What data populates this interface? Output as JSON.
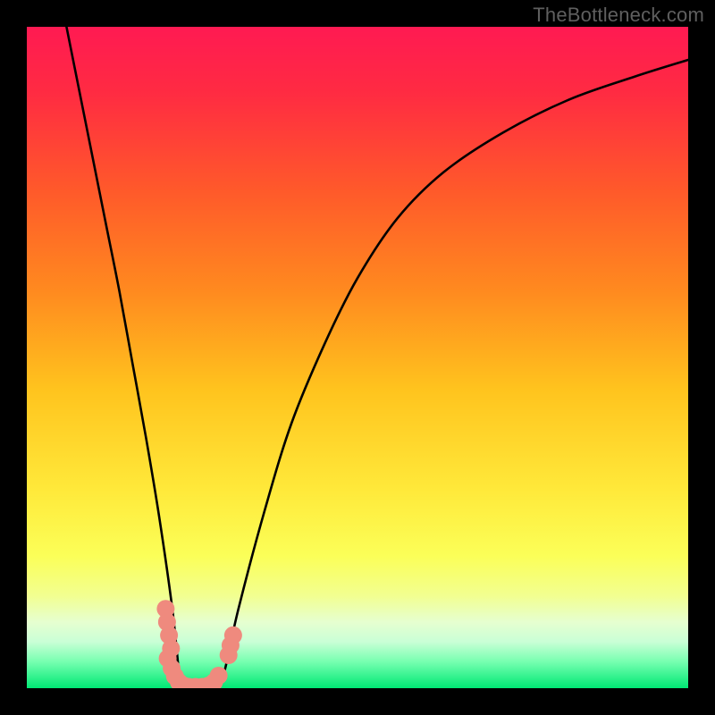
{
  "attribution": "TheBottleneck.com",
  "chart_data": {
    "type": "line",
    "title": "",
    "xlabel": "",
    "ylabel": "",
    "xlim": [
      0,
      100
    ],
    "ylim": [
      0,
      100
    ],
    "gradient_stops": [
      {
        "offset": 0,
        "color": "#ff1a52"
      },
      {
        "offset": 10,
        "color": "#ff2b42"
      },
      {
        "offset": 25,
        "color": "#ff5a2a"
      },
      {
        "offset": 40,
        "color": "#ff8a1f"
      },
      {
        "offset": 55,
        "color": "#ffc41e"
      },
      {
        "offset": 70,
        "color": "#ffe93a"
      },
      {
        "offset": 80,
        "color": "#fbff58"
      },
      {
        "offset": 86,
        "color": "#f2ff90"
      },
      {
        "offset": 90,
        "color": "#e6ffd0"
      },
      {
        "offset": 93,
        "color": "#c9ffd6"
      },
      {
        "offset": 96,
        "color": "#77ffb0"
      },
      {
        "offset": 100,
        "color": "#00e874"
      }
    ],
    "series": [
      {
        "name": "bottleneck-curve",
        "color": "#000000",
        "x": [
          6,
          8,
          10,
          12,
          14,
          16,
          18,
          20,
          22,
          23.3,
          24,
          25,
          26,
          27,
          28,
          29,
          30,
          32,
          36,
          40,
          45,
          50,
          56,
          63,
          72,
          82,
          92,
          100
        ],
        "y": [
          100,
          90,
          80,
          70,
          60,
          49,
          38,
          26,
          12,
          0,
          0,
          0,
          0,
          0,
          0,
          0,
          3,
          12,
          27,
          40,
          52,
          62,
          71,
          78,
          84,
          89,
          92.5,
          95
        ]
      }
    ],
    "markers": [
      {
        "name": "left-cluster",
        "color": "#ef8a7e",
        "points": [
          [
            21.0,
            12
          ],
          [
            21.2,
            10
          ],
          [
            21.5,
            8
          ],
          [
            21.8,
            6
          ],
          [
            21.3,
            4.5
          ],
          [
            21.9,
            3.0
          ],
          [
            22.4,
            1.8
          ],
          [
            23.0,
            0.9
          ],
          [
            23.7,
            0.4
          ],
          [
            24.5,
            0.2
          ],
          [
            25.5,
            0.2
          ],
          [
            26.5,
            0.2
          ],
          [
            27.5,
            0.4
          ],
          [
            28.3,
            0.9
          ],
          [
            29.0,
            1.9
          ]
        ]
      },
      {
        "name": "right-cluster",
        "color": "#ef8a7e",
        "points": [
          [
            30.5,
            5.0
          ],
          [
            30.8,
            6.5
          ],
          [
            31.2,
            8.0
          ]
        ]
      }
    ]
  }
}
